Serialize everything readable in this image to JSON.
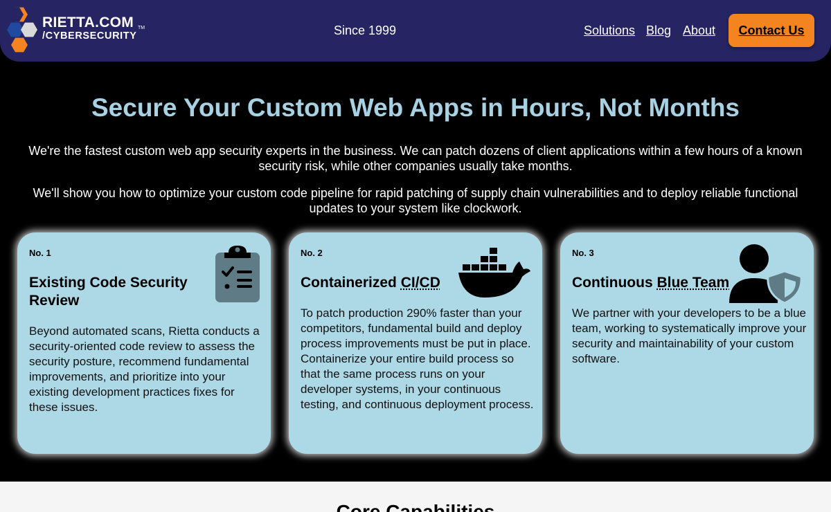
{
  "header": {
    "logo_line1": "RIETTA.COM",
    "logo_tm": "TM",
    "logo_line2": "/CYBERSECURITY",
    "tagline": "Since 1999",
    "nav": [
      "Solutions",
      "Blog",
      "About"
    ],
    "contact_label": "Contact Us"
  },
  "hero": {
    "title": "Secure Your Custom Web Apps in Hours, Not Months",
    "paragraph1": "We're the fastest custom web app security experts in the business. We can patch dozens of client applications within a few hours of a known security risk, while other companies usually take months.",
    "paragraph2": "We'll show you how to optimize your custom code pipeline for rapid patching of supply chain vulnerabilities and to deploy reliable functional updates to your system like clockwork."
  },
  "cards": [
    {
      "number": "No. 1",
      "title": "Existing Code Security Review",
      "description": "Beyond automated scans, Rietta conducts a security-oriented code review to assess the security posture, recommend fundamental improvements, and prioritize into your existing development practices fixes for these issues.",
      "icon": "clipboard-checklist-icon"
    },
    {
      "number": "No. 2",
      "title_prefix": "Containerized ",
      "title_abbr": "CI/CD",
      "description": "To patch production 290% faster than your competitors, fundamental build and deploy process improvements must be put in place. Containerize your entire build process so that the same process runs on your developer systems, in your continuous testing, and continuous deployment process.",
      "icon": "docker-whale-icon"
    },
    {
      "number": "No. 3",
      "title_prefix": "Continuous ",
      "title_abbr": "Blue Team",
      "description": "We partner with your developers to be a blue team, working to systematically improve your security and maintainability of your custom software.",
      "icon": "user-shield-icon"
    }
  ],
  "bottom": {
    "title": "Core Capabilities"
  },
  "colors": {
    "header_bg": "#262463",
    "accent_orange": "#f4841f",
    "hero_title": "#a8d2e3",
    "card_bg": "#add8e6",
    "icon_gray": "#5e7b86"
  }
}
